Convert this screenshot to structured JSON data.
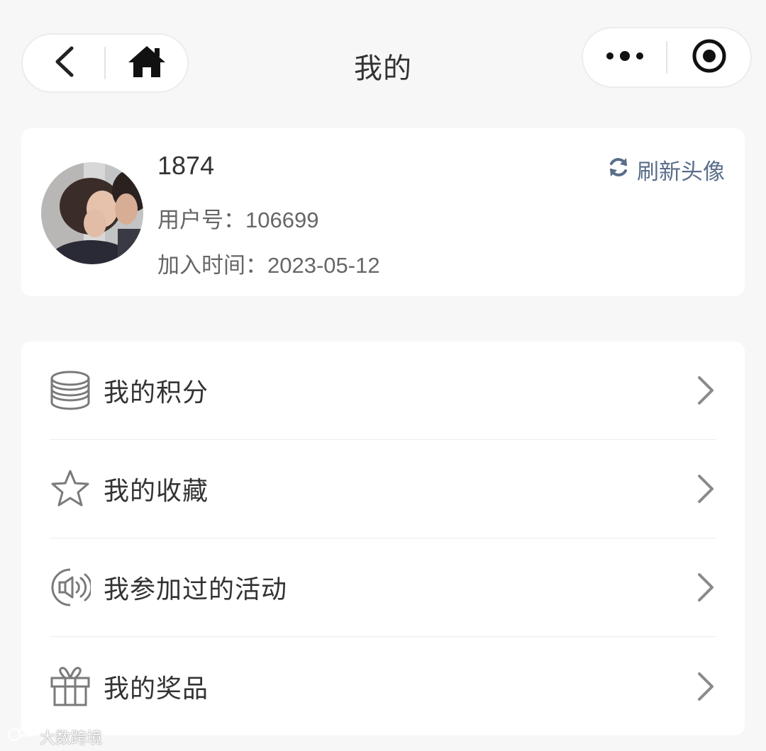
{
  "header": {
    "title": "我的",
    "back_icon": "back-arrow-icon",
    "home_icon": "home-icon",
    "more_icon": "more-dots-icon",
    "close_icon": "target-icon"
  },
  "profile": {
    "name": "1874",
    "user_id": "用户号：106699",
    "join_time": "加入时间：2023-05-12",
    "refresh_label": "刷新头像",
    "accent_color": "#5a6e8a"
  },
  "menu": {
    "items": [
      {
        "label": "我的积分",
        "icon": "coins-stack-icon"
      },
      {
        "label": "我的收藏",
        "icon": "star-icon"
      },
      {
        "label": "我参加过的活动",
        "icon": "speaker-icon"
      },
      {
        "label": "我的奖品",
        "icon": "gift-icon"
      }
    ]
  },
  "watermark": {
    "text": "大数跨境"
  }
}
